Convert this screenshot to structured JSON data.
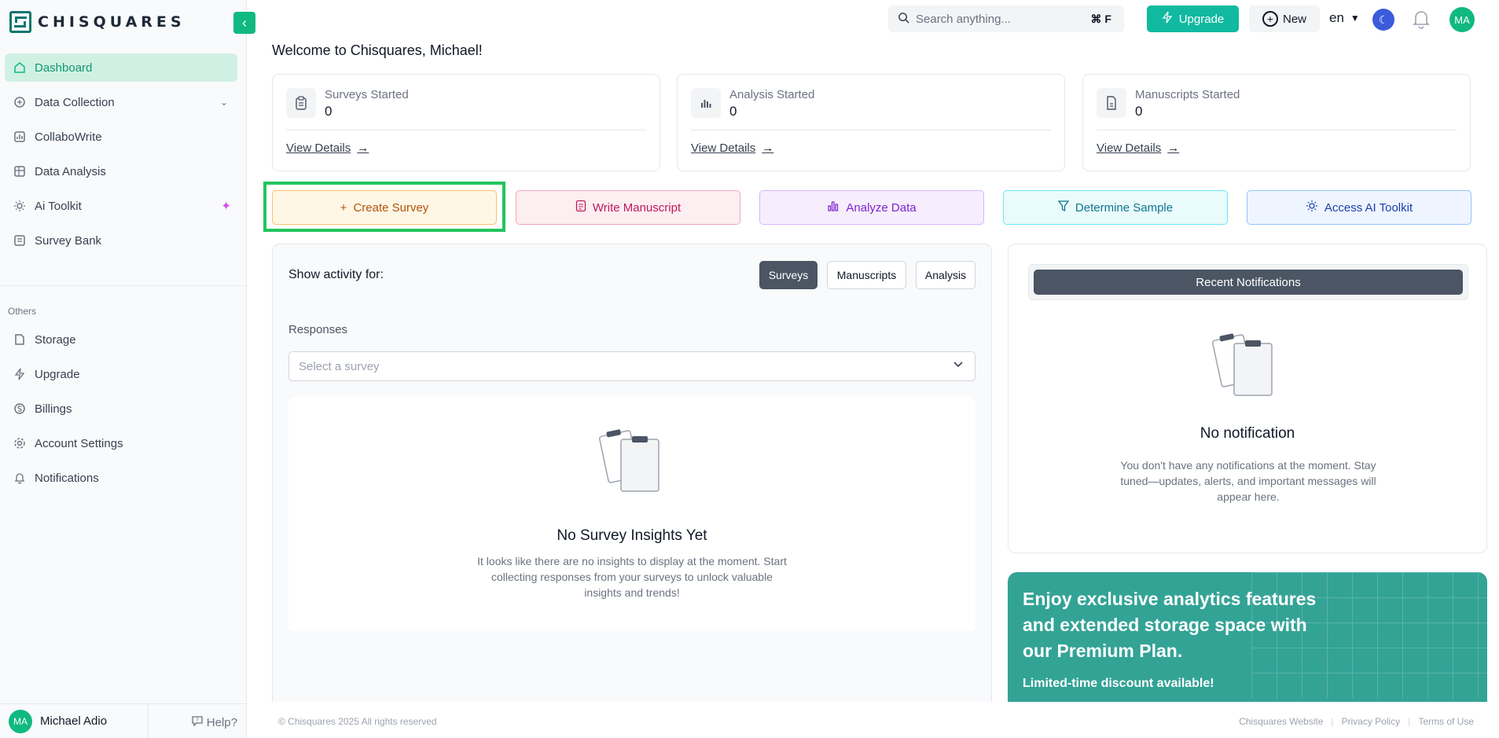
{
  "app": {
    "brand": "CHISQUARES"
  },
  "sidebar": {
    "main_items": [
      {
        "label": "Dashboard",
        "icon": "home-icon"
      },
      {
        "label": "Data Collection",
        "icon": "data-collection-icon"
      },
      {
        "label": "CollaboWrite",
        "icon": "collabowrite-icon"
      },
      {
        "label": "Data Analysis",
        "icon": "chart-icon"
      },
      {
        "label": "Ai Toolkit",
        "icon": "ai-icon"
      },
      {
        "label": "Survey Bank",
        "icon": "survey-bank-icon"
      }
    ],
    "others_label": "Others",
    "other_items": [
      {
        "label": "Storage",
        "icon": "storage-icon"
      },
      {
        "label": "Upgrade",
        "icon": "bolt-icon"
      },
      {
        "label": "Billings",
        "icon": "billing-icon"
      },
      {
        "label": "Account Settings",
        "icon": "gear-icon"
      },
      {
        "label": "Notifications",
        "icon": "bell-icon"
      }
    ],
    "user": {
      "initials": "MA",
      "name": "Michael Adio"
    },
    "help_label": "Help?"
  },
  "topbar": {
    "search_placeholder": "Search anything...",
    "search_shortcut": "⌘ F",
    "upgrade_label": "Upgrade",
    "new_label": "New",
    "language": "en",
    "avatar_initials": "MA"
  },
  "main": {
    "welcome": "Welcome to Chisquares, Michael!",
    "stats": [
      {
        "title": "Surveys Started",
        "value": "0",
        "link": "View Details"
      },
      {
        "title": "Analysis Started",
        "value": "0",
        "link": "View Details"
      },
      {
        "title": "Manuscripts Started",
        "value": "0",
        "link": "View Details"
      }
    ],
    "actions": [
      {
        "label": "Create Survey",
        "icon": "plus-icon"
      },
      {
        "label": "Write Manuscript",
        "icon": "document-icon"
      },
      {
        "label": "Analyze Data",
        "icon": "bar-chart-icon"
      },
      {
        "label": "Determine Sample",
        "icon": "filter-icon"
      },
      {
        "label": "Access AI Toolkit",
        "icon": "sparkle-gear-icon"
      }
    ],
    "activity": {
      "label": "Show activity for:",
      "tabs": [
        "Surveys",
        "Manuscripts",
        "Analysis"
      ],
      "responses_label": "Responses",
      "select_placeholder": "Select a survey",
      "empty_title": "No Survey Insights Yet",
      "empty_desc": "It looks like there are no insights to display at the moment. Start collecting responses from your surveys to unlock valuable insights and trends!"
    },
    "notifications": {
      "header": "Recent Notifications",
      "empty_title": "No notification",
      "empty_desc": "You don't have any notifications at the moment. Stay tuned—updates, alerts, and important messages will appear here."
    },
    "premium": {
      "title": "Enjoy exclusive analytics features and extended storage space with our Premium Plan.",
      "subtitle": "Limited-time discount available!"
    }
  },
  "footer": {
    "copyright": "© Chisquares 2025 All rights reserved",
    "links": [
      "Chisquares Website",
      "Privacy Policy",
      "Terms of Use"
    ]
  }
}
